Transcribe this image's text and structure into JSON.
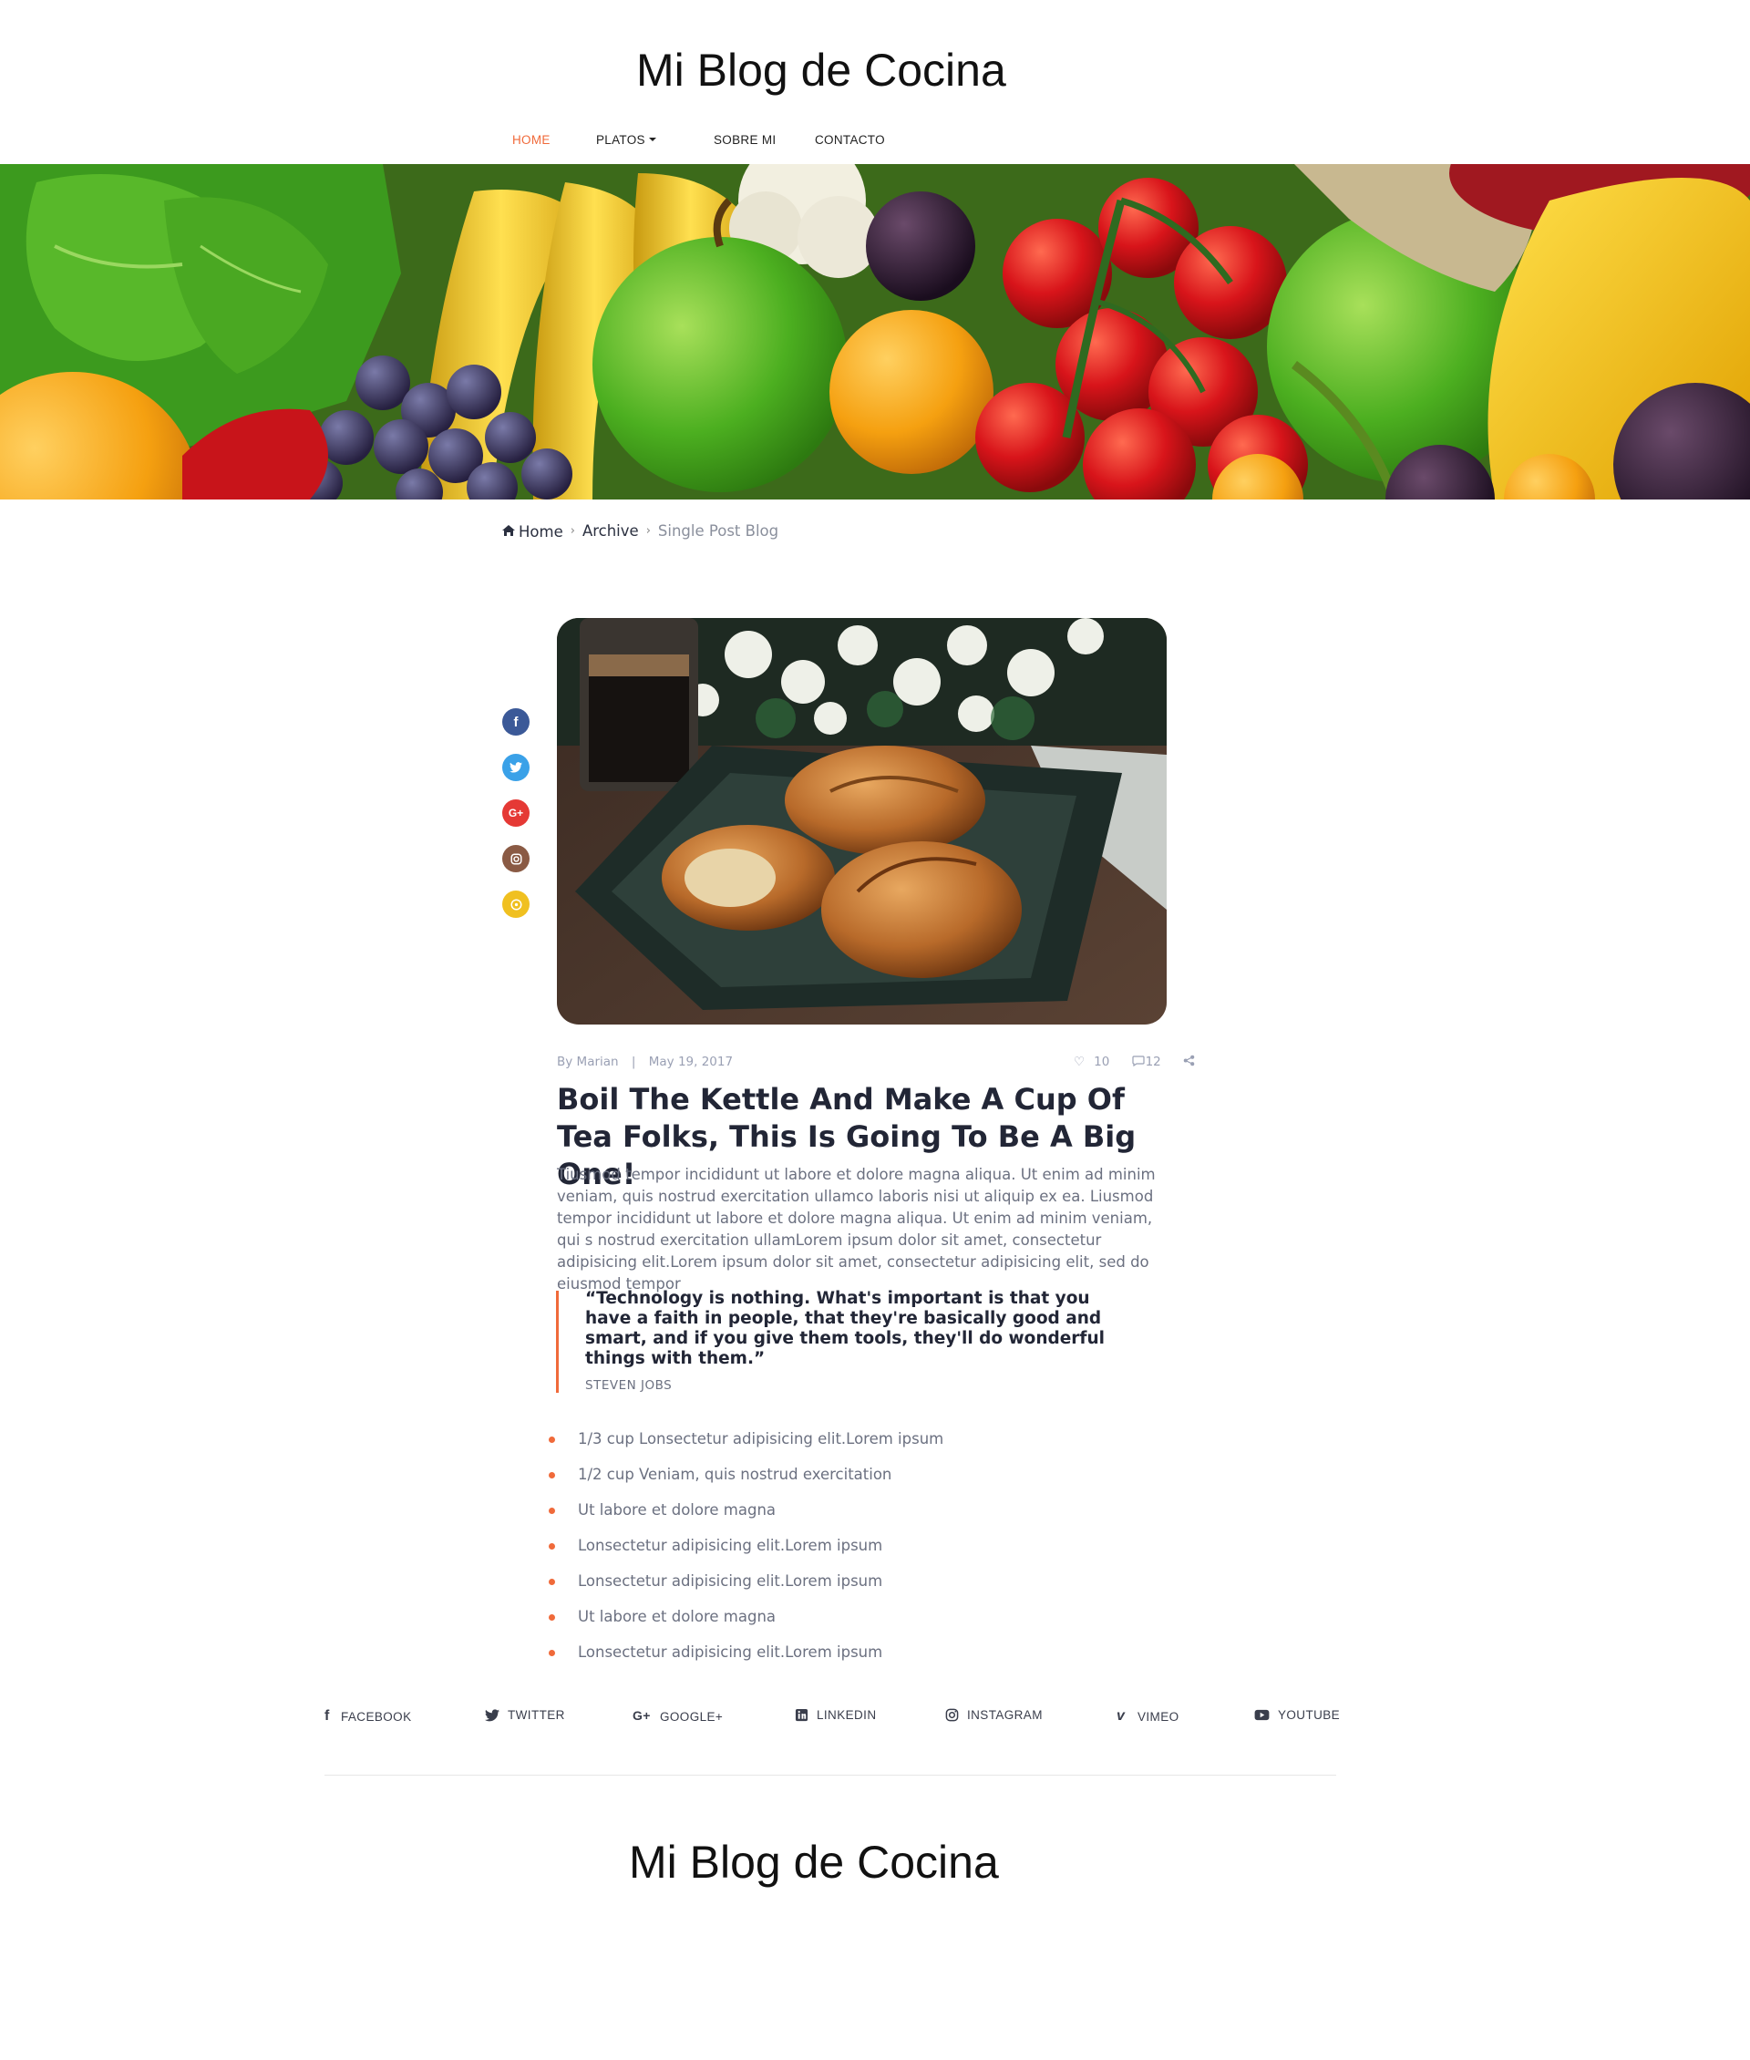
{
  "header": {
    "title": "Mi Blog de Cocina",
    "nav": [
      {
        "label": "HOME",
        "active": true
      },
      {
        "label": "PLATOS",
        "dropdown": true
      },
      {
        "label": "SOBRE MI"
      },
      {
        "label": "CONTACTO"
      }
    ]
  },
  "breadcrumb": {
    "home": "Home",
    "archive": "Archive",
    "current": "Single Post Blog"
  },
  "share_sidebar": [
    "facebook-icon",
    "twitter-icon",
    "google-plus-icon",
    "instagram-icon",
    "pinterest-icon"
  ],
  "post": {
    "author": "By Marian",
    "separator": "|",
    "date": "May 19, 2017",
    "likes": "10",
    "comments": "12",
    "title": "Boil The Kettle And Make A Cup Of Tea Folks, This Is Going To Be A Big One!",
    "body": "Tiusmod tempor incididunt ut labore et dolore magna aliqua. Ut enim ad minim veniam, quis nostrud exercitation ullamco laboris nisi ut aliquip ex ea. Liusmod tempor incididunt ut labore et dolore magna aliqua. Ut enim ad minim veniam, qui s nostrud exercitation ullamLorem ipsum dolor sit amet, consectetur adipisicing elit.Lorem ipsum dolor sit amet, consectetur adipisicing elit, sed do eiusmod tempor",
    "quote": "“Technology is nothing. What's important is that you have a faith in people, that they're basically good and smart, and if you give them tools, they'll do wonderful things with them.”",
    "quote_author": "STEVEN JOBS",
    "list": [
      "1/3 cup Lonsectetur adipisicing elit.Lorem ipsum",
      "1/2 cup Veniam, quis nostrud exercitation",
      "Ut labore et dolore magna",
      "Lonsectetur adipisicing elit.Lorem ipsum",
      "Lonsectetur adipisicing elit.Lorem ipsum",
      "Ut labore et dolore magna",
      "Lonsectetur adipisicing elit.Lorem ipsum"
    ]
  },
  "footer": {
    "social": [
      {
        "label": "FACEBOOK",
        "icon": "facebook-icon"
      },
      {
        "label": "TWITTER",
        "icon": "twitter-icon"
      },
      {
        "label": "GOOGLE+",
        "icon": "google-plus-icon"
      },
      {
        "label": "LINKEDIN",
        "icon": "linkedin-icon"
      },
      {
        "label": "INSTAGRAM",
        "icon": "instagram-icon"
      },
      {
        "label": "VIMEO",
        "icon": "vimeo-icon"
      },
      {
        "label": "YOUTUBE",
        "icon": "youtube-icon"
      }
    ],
    "title": "Mi Blog de Cocina"
  },
  "colors": {
    "accent": "#f06a3a",
    "facebook": "#3b5998",
    "twitter": "#3aa1e8",
    "google": "#e53935",
    "instagram": "#8a5a44",
    "pinterest": "#f0c020"
  }
}
